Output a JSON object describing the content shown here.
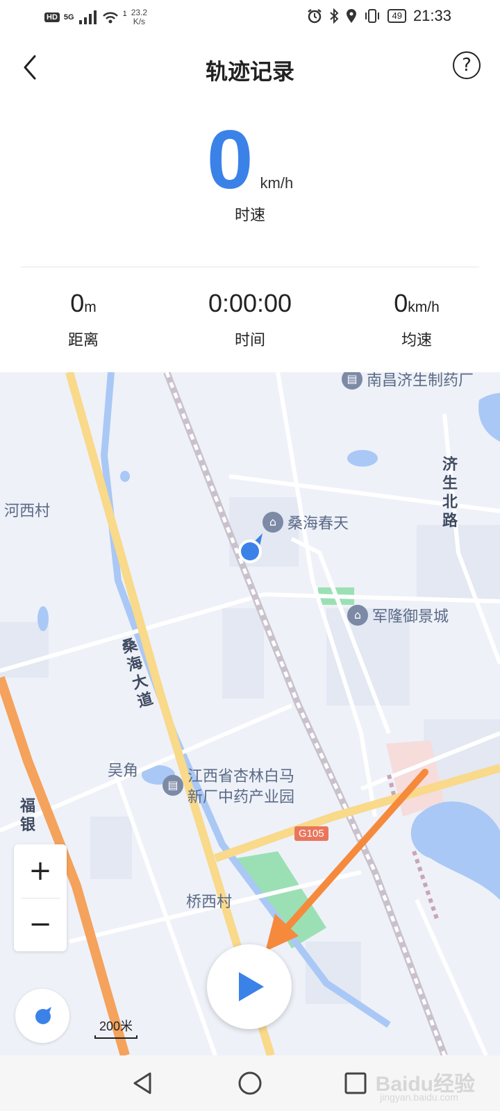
{
  "status_bar": {
    "hd": "HD",
    "network": "5G",
    "wifi_count": "1",
    "net_speed_value": "23.2",
    "net_speed_unit": "K/s",
    "battery": "49",
    "time": "21:33"
  },
  "header": {
    "title": "轨迹记录",
    "back_icon": "chevron-left-icon",
    "help_icon": "question-circle-icon",
    "help_label": "?"
  },
  "speed": {
    "value": "0",
    "unit": "km/h",
    "label": "时速"
  },
  "stats": [
    {
      "value": "0",
      "unit": "m",
      "label": "距离"
    },
    {
      "value": "0:00:00",
      "unit": "",
      "label": "时间"
    },
    {
      "value": "0",
      "unit": "km/h",
      "label": "均速"
    }
  ],
  "map": {
    "labels": {
      "hexicun": "河西村",
      "wujiao": "吴角",
      "qiaoxicun": "桥西村",
      "jisheng_road": "济生北路",
      "sanghai_avenue": "桑海大道",
      "fuyin_road": "福银"
    },
    "pois": {
      "pharma": "南昌济生制药厂",
      "sanghai_spring": "桑海春天",
      "junlong": "军隆御景城",
      "industrial_park_line1": "江西省杏林白马",
      "industrial_park_line2": "新厂中药产业园"
    },
    "road_badge": "G105",
    "scale": "200米",
    "zoom_in": "+",
    "zoom_out": "−",
    "colors": {
      "accent": "#3b82e8",
      "map_bg": "#eef1f8",
      "road_major": "#f9d98a",
      "expressway": "#f4a25c",
      "water": "#a9c8f5",
      "arrow": "#f58a3c"
    }
  },
  "nav": {
    "back_icon": "triangle-back-icon",
    "home_icon": "circle-home-icon",
    "recent_icon": "square-recent-icon"
  },
  "watermark": {
    "text": "Baidu经验",
    "sub": "jingyan.baidu.com"
  }
}
